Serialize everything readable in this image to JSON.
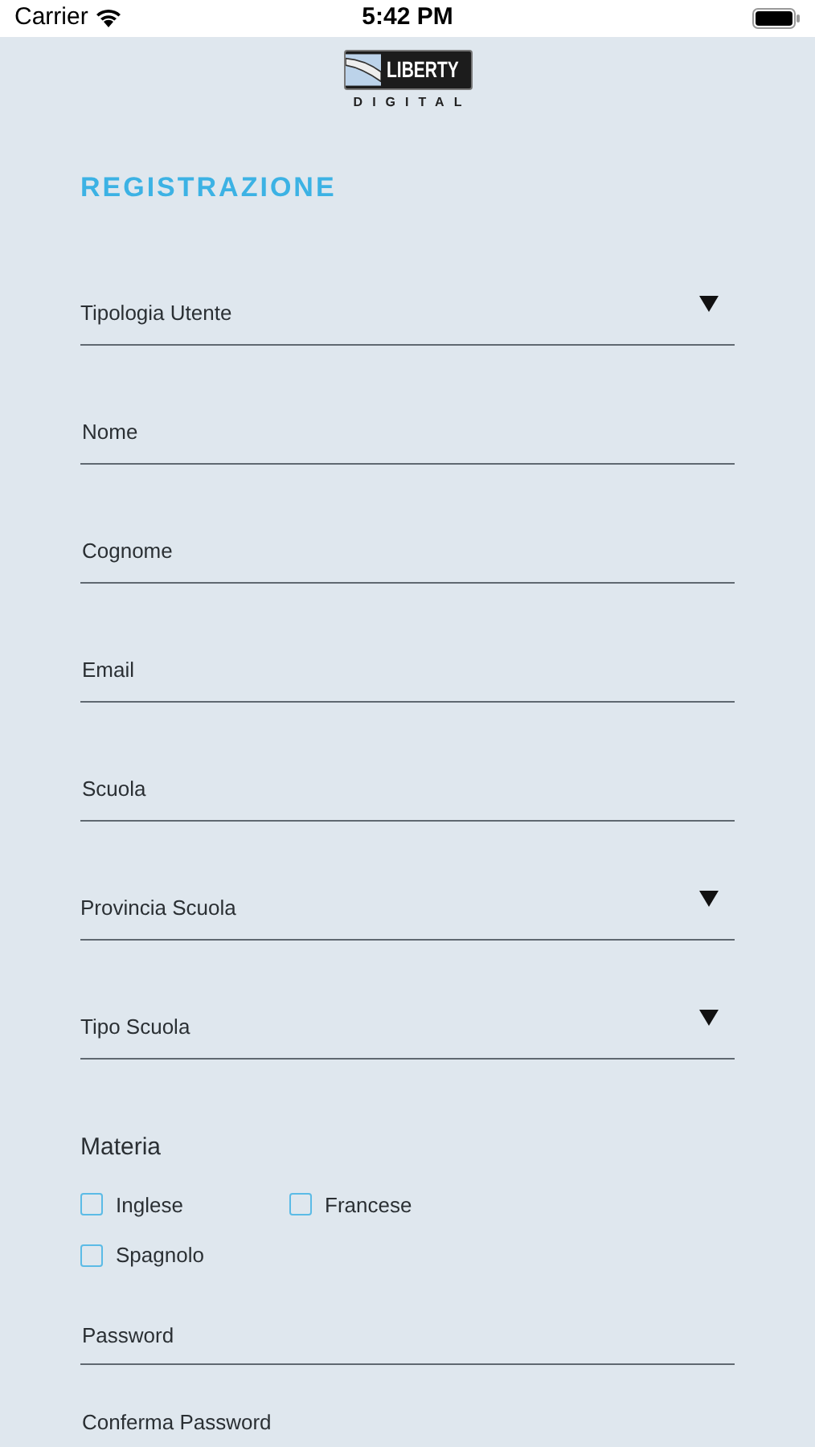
{
  "status_bar": {
    "carrier": "Carrier",
    "time": "5:42 PM"
  },
  "logo": {
    "word": "LIBERTY",
    "subword": "DIGITAL"
  },
  "title": "REGISTRAZIONE",
  "fields": [
    {
      "kind": "dropdown",
      "placeholder": "Tipologia Utente"
    },
    {
      "kind": "text",
      "placeholder": "Nome"
    },
    {
      "kind": "text",
      "placeholder": "Cognome"
    },
    {
      "kind": "text",
      "placeholder": "Email"
    },
    {
      "kind": "text",
      "placeholder": "Scuola"
    },
    {
      "kind": "dropdown",
      "placeholder": "Provincia Scuola"
    },
    {
      "kind": "dropdown",
      "placeholder": "Tipo Scuola"
    }
  ],
  "subjects": {
    "label": "Materia",
    "options": [
      {
        "label": "Inglese",
        "checked": false
      },
      {
        "label": "Francese",
        "checked": false
      },
      {
        "label": "Spagnolo",
        "checked": false
      }
    ]
  },
  "password_fields": [
    {
      "placeholder": "Password"
    },
    {
      "placeholder": "Conferma Password"
    }
  ]
}
